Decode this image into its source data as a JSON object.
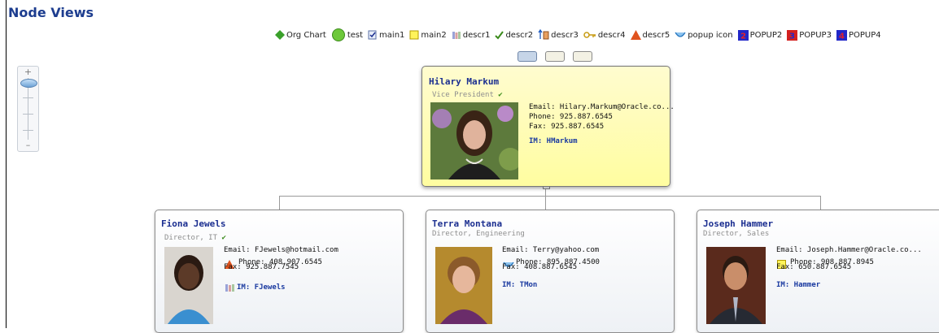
{
  "page": {
    "title": "Node Views"
  },
  "legend": [
    {
      "icon": "green-diamond-icon",
      "label": "Org Chart"
    },
    {
      "icon": "green-circle-icon",
      "label": "test"
    },
    {
      "icon": "doc-check-icon",
      "label": "main1"
    },
    {
      "icon": "yellow-square-icon",
      "label": "main2"
    },
    {
      "icon": "books-icon",
      "label": "descr1"
    },
    {
      "icon": "checkmark-icon",
      "label": "descr2"
    },
    {
      "icon": "arrows-updown-icon",
      "label": "descr3"
    },
    {
      "icon": "key-icon",
      "label": "descr4"
    },
    {
      "icon": "orange-triangle-icon",
      "label": "descr5"
    },
    {
      "icon": "bowl-icon",
      "label": "popup icon"
    },
    {
      "icon": "badge-2-icon",
      "label": "POPUP2"
    },
    {
      "icon": "badge-3-icon",
      "label": "POPUP3"
    },
    {
      "icon": "badge-4-icon",
      "label": "POPUP4"
    }
  ],
  "colors": {
    "accent": "#1a2e90",
    "root_bg": "#fffda0",
    "check": "#3a8a1a"
  },
  "root": {
    "name": "Hilary Markum",
    "title": "Vice President",
    "email": "Email: Hilary.Markum@Oracle.co...",
    "phone": "Phone: 925.887.6545",
    "fax": "Fax: 925.887.6545",
    "im": "IM: HMarkum"
  },
  "children": [
    {
      "name": "Fiona Jewels",
      "title": "Director, IT",
      "email": "Email: FJewels@hotmail.com",
      "phone": "Phone: 408.907.6545",
      "fax": "Fax: 925.887.7545",
      "im": "IM: FJewels"
    },
    {
      "name": "Terra Montana",
      "title": "Director, Engineering",
      "email": "Email: Terry@yahoo.com",
      "phone": "Phone: 895.887.4500",
      "fax": "Fax: 408.887.6545",
      "im": "IM: TMon"
    },
    {
      "name": "Joseph Hammer",
      "title": "Director, Sales",
      "email": "Email: Joseph.Hammer@Oracle.co...",
      "phone": "Phone: 908.887.8945",
      "fax": "Fax: 650.887.6545",
      "im": "IM: Hammer"
    }
  ]
}
